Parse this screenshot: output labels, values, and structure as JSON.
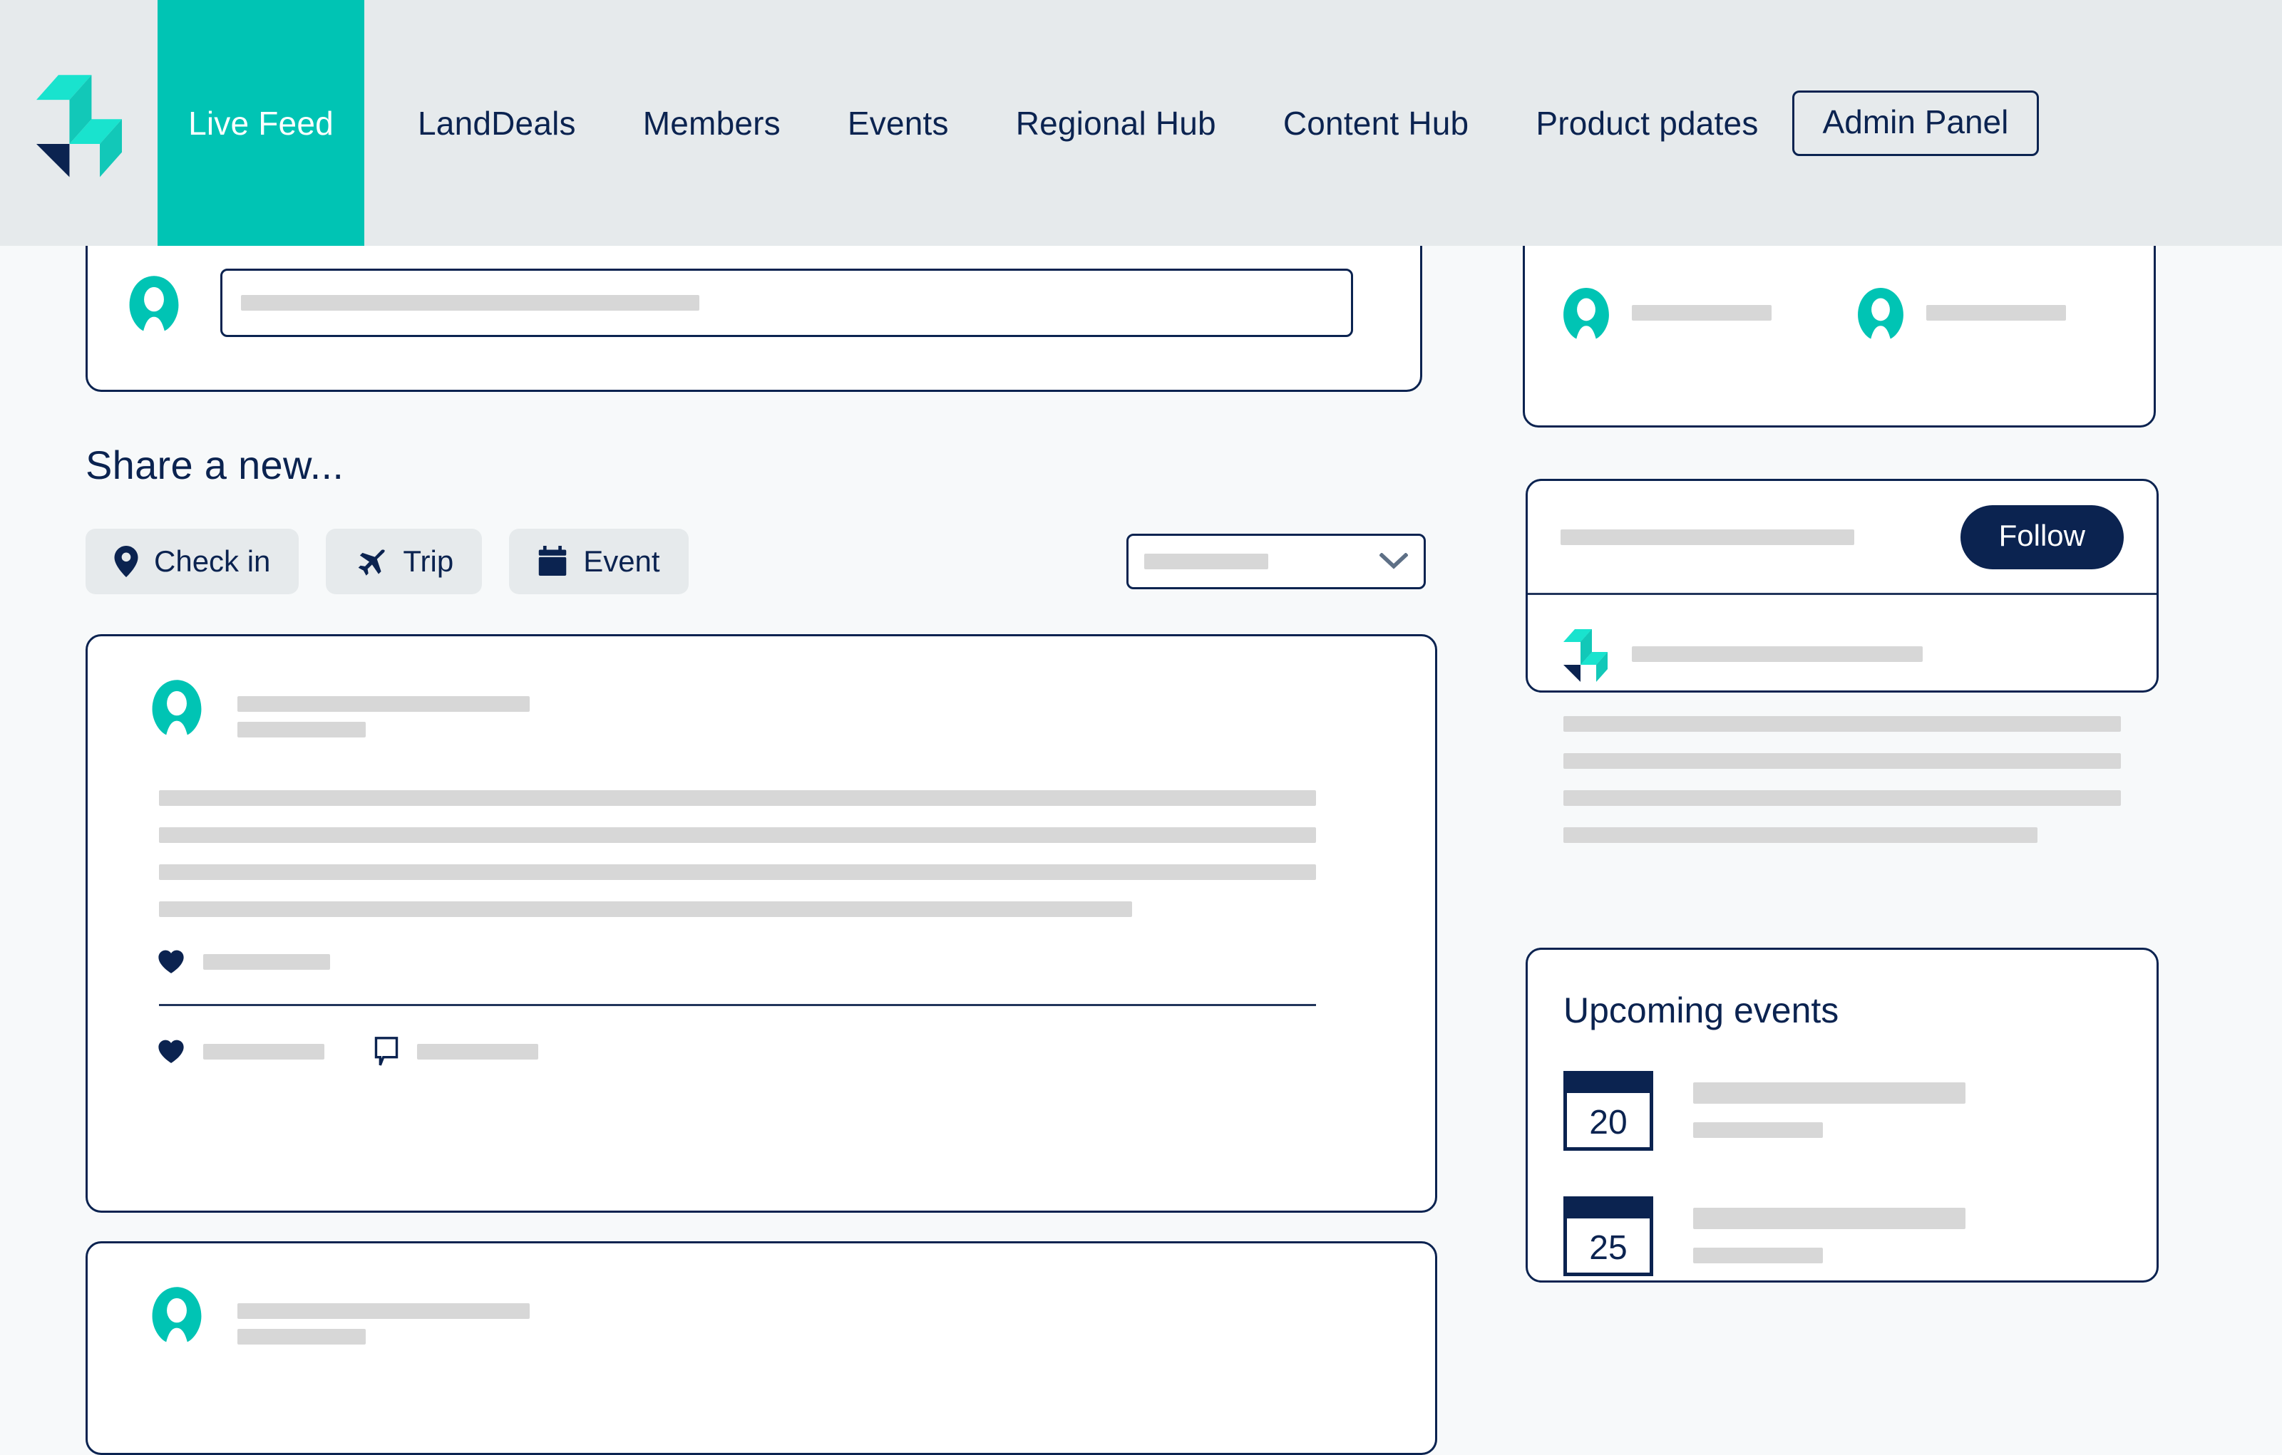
{
  "brand": {
    "logo_icon": "lightning-bolt-logo",
    "teal": "#00C4B4",
    "teal_light": "#19E3CE",
    "navy": "#0B2350",
    "header_bg": "#E6EAEC",
    "page_bg": "#F7F9FA",
    "skeleton": "#D7D7D7"
  },
  "header": {
    "nav_items": [
      {
        "label": "Live Feed",
        "active": true
      },
      {
        "label": "LandDeals",
        "active": false
      },
      {
        "label": "Members",
        "active": false
      },
      {
        "label": "Events",
        "active": false
      },
      {
        "label": "Regional Hub",
        "active": false
      },
      {
        "label": "Content Hub",
        "active": false
      },
      {
        "label": "Product pdates",
        "active": false
      }
    ],
    "admin_button": "Admin Panel"
  },
  "composer": {
    "avatar_icon": "user-avatar",
    "placeholder_width_pct": 42
  },
  "share": {
    "title": "Share a new...",
    "chips": [
      {
        "label": "Check in",
        "icon": "location-pin-icon"
      },
      {
        "label": "Trip",
        "icon": "airplane-icon"
      },
      {
        "label": "Event",
        "icon": "calendar-icon"
      }
    ],
    "select": {
      "value": "",
      "placeholder_width_pct": 47,
      "chevron_icon": "chevron-down-icon"
    }
  },
  "feed": {
    "posts": [
      {
        "avatar_icon": "user-avatar",
        "name_width": 410,
        "meta_width": 180,
        "body_lines": [
          100,
          100,
          100,
          84
        ],
        "like_icon": "heart-icon",
        "like_count_width": 178,
        "actions": [
          {
            "icon": "heart-icon",
            "label_width": 170
          },
          {
            "icon": "comment-bubble-icon",
            "label_width": 170
          }
        ]
      },
      {
        "avatar_icon": "user-avatar",
        "name_width": 410,
        "meta_width": 180,
        "body_lines": [],
        "like_icon": "heart-icon",
        "like_count_width": 0,
        "actions": []
      }
    ]
  },
  "sidebar": {
    "members_card": {
      "members": [
        {
          "avatar_icon": "user-avatar",
          "name_width": 196
        },
        {
          "avatar_icon": "user-avatar",
          "name_width": 196
        },
        {
          "avatar_icon": "user-avatar",
          "name_width": 196
        },
        {
          "avatar_icon": "user-avatar",
          "name_width": 196
        }
      ]
    },
    "follow_card": {
      "title_width": 412,
      "follow_button": "Follow",
      "org_logo_icon": "lightning-bolt-logo",
      "org_name_width": 408,
      "body_lines": [
        100,
        100,
        100,
        85
      ]
    },
    "events_card": {
      "title": "Upcoming events",
      "events": [
        {
          "day": "20",
          "title_width": 382,
          "meta_width": 182
        },
        {
          "day": "25",
          "title_width": 382,
          "meta_width": 182
        }
      ]
    }
  }
}
